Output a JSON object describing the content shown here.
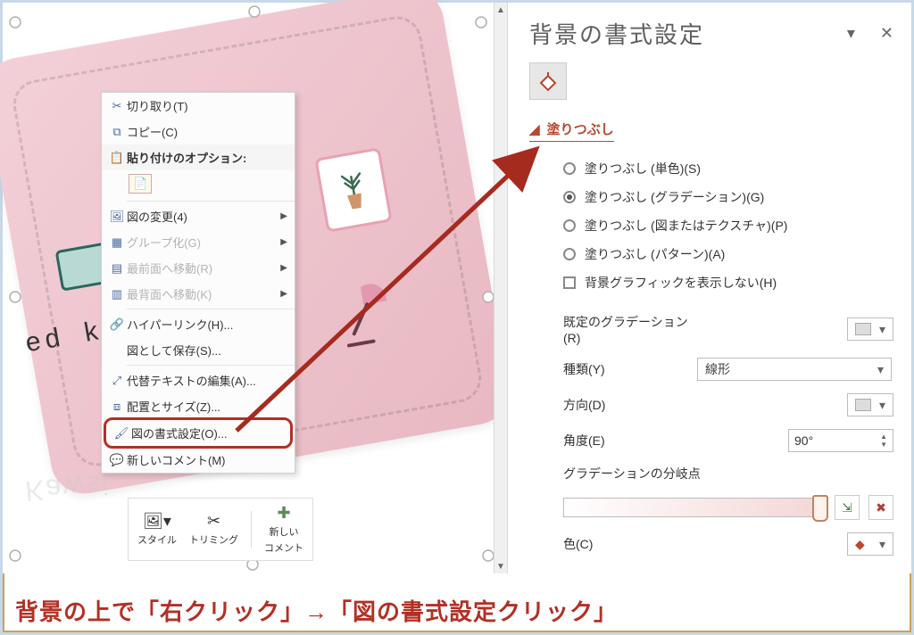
{
  "canvas": {
    "text_fragment": "ed   k",
    "reflection_text": "Kawsi"
  },
  "context_menu": {
    "cut": "切り取り(T)",
    "copy": "コピー(C)",
    "paste_options": "貼り付けのオプション:",
    "change_picture": "図の変更(4)",
    "group": "グループ化(G)",
    "bring_front": "最前面へ移動(R)",
    "send_back": "最背面へ移動(K)",
    "hyperlink": "ハイパーリンク(H)...",
    "save_as_picture": "図として保存(S)...",
    "alt_text": "代替テキストの編集(A)...",
    "size_position": "配置とサイズ(Z)...",
    "format_picture": "図の書式設定(O)...",
    "new_comment": "新しいコメント(M)"
  },
  "mini_toolbar": {
    "style": "スタイル",
    "crop": "トリミング",
    "new_comment_l1": "新しい",
    "new_comment_l2": "コメント"
  },
  "format_pane": {
    "title": "背景の書式設定",
    "fill_section": "塗りつぶし",
    "fill_options": [
      "塗りつぶし (単色)(S)",
      "塗りつぶし (グラデーション)(G)",
      "塗りつぶし (図またはテクスチャ)(P)",
      "塗りつぶし (パターン)(A)"
    ],
    "hide_bg_graphics": "背景グラフィックを表示しない(H)",
    "labels": {
      "preset": "既定のグラデーション(R)",
      "type": "種類(Y)",
      "direction": "方向(D)",
      "angle": "角度(E)",
      "stops": "グラデーションの分岐点",
      "color": "色(C)"
    },
    "values": {
      "type": "線形",
      "angle": "90°"
    }
  },
  "instruction": "背景の上で「右クリック」→「図の書式設定クリック」",
  "colors": {
    "accent": "#b8472e",
    "annotation": "#a62b1f",
    "slide_bg_from": "#f3d0d8",
    "slide_bg_to": "#e8b8c2"
  }
}
